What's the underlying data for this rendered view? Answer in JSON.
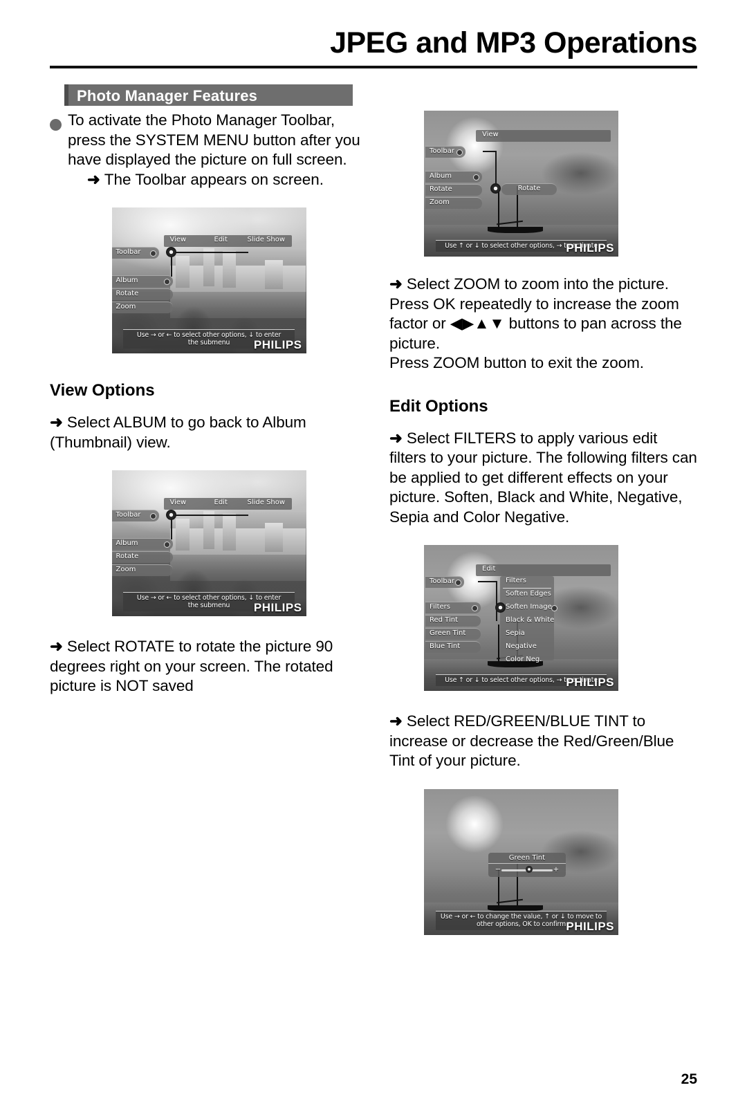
{
  "header": {
    "title": "JPEG and MP3 Operations"
  },
  "section": {
    "title": "Photo Manager Features"
  },
  "left_column": {
    "intro_paragraph": "To activate the Photo Manager Toolbar, press the SYSTEM MENU button after you have displayed the picture on full screen.",
    "intro_sub": "The Toolbar appears on screen.",
    "view_options_heading": "View Options",
    "album_paragraph": "Select ALBUM to go back to Album (Thumbnail) view.",
    "rotate_paragraph": "Select ROTATE to rotate the picture 90 degrees right on your screen. The rotated picture is NOT saved"
  },
  "right_column": {
    "zoom_paragraph": "Select ZOOM to zoom into the picture. Press OK repeatedly to increase the zoom factor or ◀▶▲▼ buttons to pan across the picture.",
    "zoom_exit_line": "Press ZOOM button to exit the zoom.",
    "edit_options_heading": "Edit Options",
    "filters_paragraph": "Select FILTERS to apply various edit filters to your picture. The following filters can be applied to get different effects on your picture. Soften, Black and White, Negative, Sepia and Color Negative.",
    "tint_paragraph": "Select RED/GREEN/BLUE TINT to increase or decrease the Red/Green/Blue Tint of your picture."
  },
  "screenshots": {
    "toolbar_view_1": {
      "tabs": [
        "View",
        "Edit",
        "Slide Show"
      ],
      "menu_items": [
        "Toolbar",
        "Album",
        "Rotate",
        "Zoom"
      ],
      "help_line_1": "Use → or ← to select other options,  ↓ to enter",
      "help_line_2": "the submenu",
      "brand": "PHILIPS"
    },
    "toolbar_view_2": {
      "tabs": [
        "View",
        "Edit",
        "Slide Show"
      ],
      "menu_items": [
        "Toolbar",
        "Album",
        "Rotate",
        "Zoom"
      ],
      "help_line_1": "Use → or ← to select other options,  ↓ to enter",
      "help_line_2": "the submenu",
      "brand": "PHILIPS"
    },
    "rotate_submenu": {
      "tab": "View",
      "menu_items": [
        "Toolbar",
        "Album",
        "Rotate",
        "Zoom"
      ],
      "submenu_items": [
        "Rotate"
      ],
      "help_line_1": "Use ↑ or ↓ to select other options, → to activate",
      "brand": "PHILIPS"
    },
    "filters_submenu": {
      "tab": "Edit",
      "menu_items": [
        "Toolbar",
        "Filters",
        "Red Tint",
        "Green Tint",
        "Blue Tint"
      ],
      "submenu_items": [
        "Filters",
        "Soften Edges",
        "Soften Image",
        "Black & White",
        "Sepia",
        "Negative",
        "Color Neg."
      ],
      "help_line_1": "Use ↑ or ↓ to select other options, → to activate",
      "brand": "PHILIPS"
    },
    "green_tint": {
      "panel_title": "Green Tint",
      "minus_label": "−",
      "plus_label": "+",
      "help_line_1": "Use → or ← to change the value,  ↑ or ↓ to move to",
      "help_line_2": "other options, OK to confirm",
      "brand": "PHILIPS"
    }
  },
  "footer": {
    "page_number": "25"
  },
  "colors": {
    "section_bar": "#6e6e6e",
    "bullet": "#6b6b6b",
    "text": "#000000"
  }
}
